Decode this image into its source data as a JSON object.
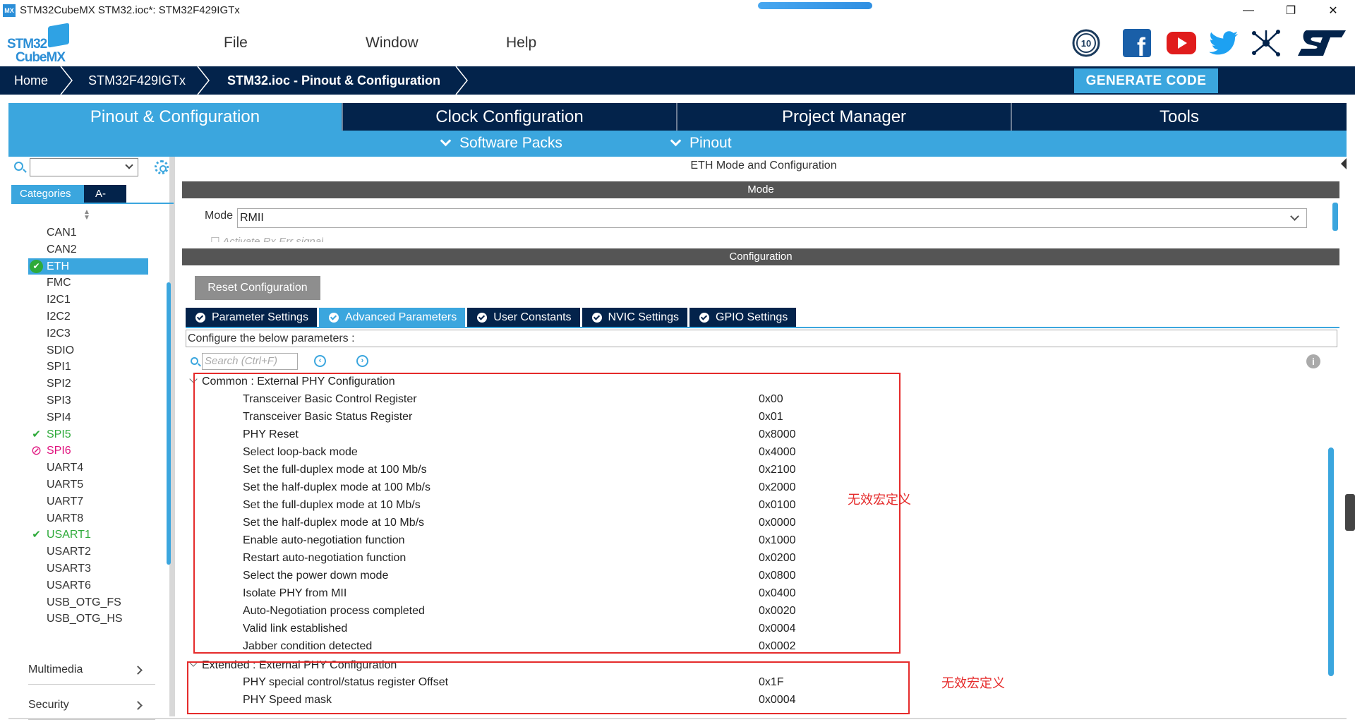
{
  "window": {
    "title": "STM32CubeMX STM32.ioc*: STM32F429IGTx",
    "app_icon": "MX",
    "minimize": "—",
    "restore": "❐",
    "close": "✕"
  },
  "logo": {
    "line1": "STM32",
    "line2": "CubeMX"
  },
  "menu": {
    "file": "File",
    "window": "Window",
    "help": "Help"
  },
  "social": {
    "anniversary": "10",
    "facebook": "f"
  },
  "breadcrumb": {
    "home": "Home",
    "device": "STM32F429IGTx",
    "current": "STM32.ioc - Pinout & Configuration",
    "generate": "GENERATE CODE"
  },
  "tabs": {
    "pinout": "Pinout & Configuration",
    "clock": "Clock Configuration",
    "project": "Project Manager",
    "tools": "Tools"
  },
  "subtabs": {
    "software_packs": "Software Packs",
    "pinout": "Pinout"
  },
  "left": {
    "categories_tab": "Categories",
    "az_tab": "A->Z",
    "items": [
      {
        "label": "CAN1",
        "status": ""
      },
      {
        "label": "CAN2",
        "status": ""
      },
      {
        "label": "ETH",
        "status": "selected"
      },
      {
        "label": "FMC",
        "status": ""
      },
      {
        "label": "I2C1",
        "status": ""
      },
      {
        "label": "I2C2",
        "status": ""
      },
      {
        "label": "I2C3",
        "status": ""
      },
      {
        "label": "SDIO",
        "status": ""
      },
      {
        "label": "SPI1",
        "status": ""
      },
      {
        "label": "SPI2",
        "status": ""
      },
      {
        "label": "SPI3",
        "status": ""
      },
      {
        "label": "SPI4",
        "status": ""
      },
      {
        "label": "SPI5",
        "status": "ok"
      },
      {
        "label": "SPI6",
        "status": "conflict"
      },
      {
        "label": "UART4",
        "status": ""
      },
      {
        "label": "UART5",
        "status": ""
      },
      {
        "label": "UART7",
        "status": ""
      },
      {
        "label": "UART8",
        "status": ""
      },
      {
        "label": "USART1",
        "status": "ok"
      },
      {
        "label": "USART2",
        "status": ""
      },
      {
        "label": "USART3",
        "status": ""
      },
      {
        "label": "USART6",
        "status": ""
      },
      {
        "label": "USB_OTG_FS",
        "status": ""
      },
      {
        "label": "USB_OTG_HS",
        "status": ""
      }
    ],
    "sections": {
      "multimedia": "Multimedia",
      "security": "Security"
    }
  },
  "right": {
    "title": "ETH Mode and Configuration",
    "mode_bar": "Mode",
    "mode_label": "Mode",
    "mode_value": "RMII",
    "mode_checkbox": "Activate Rx Err signal",
    "config_bar": "Configuration",
    "reset_button": "Reset Configuration",
    "config_tabs": [
      "Parameter Settings",
      "Advanced Parameters",
      "User Constants",
      "NVIC Settings",
      "GPIO Settings"
    ],
    "configure_text": "Configure the below parameters :",
    "search_placeholder": "Search (Ctrl+F)",
    "nav_prev": "‹",
    "nav_next": "›",
    "info": "i"
  },
  "common_group": {
    "title": "Common : External PHY Configuration",
    "rows": [
      {
        "name": "Transceiver Basic Control Register",
        "value": "0x00"
      },
      {
        "name": "Transceiver Basic Status Register",
        "value": "0x01"
      },
      {
        "name": "PHY Reset",
        "value": "0x8000"
      },
      {
        "name": "Select loop-back mode",
        "value": "0x4000"
      },
      {
        "name": "Set the full-duplex mode at 100 Mb/s",
        "value": "0x2100"
      },
      {
        "name": "Set the half-duplex mode at 100 Mb/s",
        "value": "0x2000"
      },
      {
        "name": "Set the full-duplex mode at 10 Mb/s",
        "value": "0x0100"
      },
      {
        "name": "Set the half-duplex mode at 10 Mb/s",
        "value": "0x0000"
      },
      {
        "name": "Enable auto-negotiation function",
        "value": "0x1000"
      },
      {
        "name": "Restart auto-negotiation function",
        "value": "0x0200"
      },
      {
        "name": "Select the power down mode",
        "value": "0x0800"
      },
      {
        "name": "Isolate PHY from MII",
        "value": "0x0400"
      },
      {
        "name": "Auto-Negotiation process completed",
        "value": "0x0020"
      },
      {
        "name": "Valid link established",
        "value": "0x0004"
      },
      {
        "name": "Jabber condition detected",
        "value": "0x0002"
      }
    ]
  },
  "extended_group": {
    "title": "Extended : External PHY Configuration",
    "rows": [
      {
        "name": "PHY special control/status register Offset",
        "value": "0x1F"
      },
      {
        "name": "PHY Speed mask",
        "value": "0x0004"
      }
    ]
  },
  "annotations": {
    "note1": "无效宏定义",
    "note2": "无效宏定义"
  },
  "colors": {
    "navy": "#03234b",
    "accent": "#3ba6de",
    "annotation": "#e52b2b",
    "ok": "#2eaa3a",
    "conflict": "#e0117d"
  }
}
